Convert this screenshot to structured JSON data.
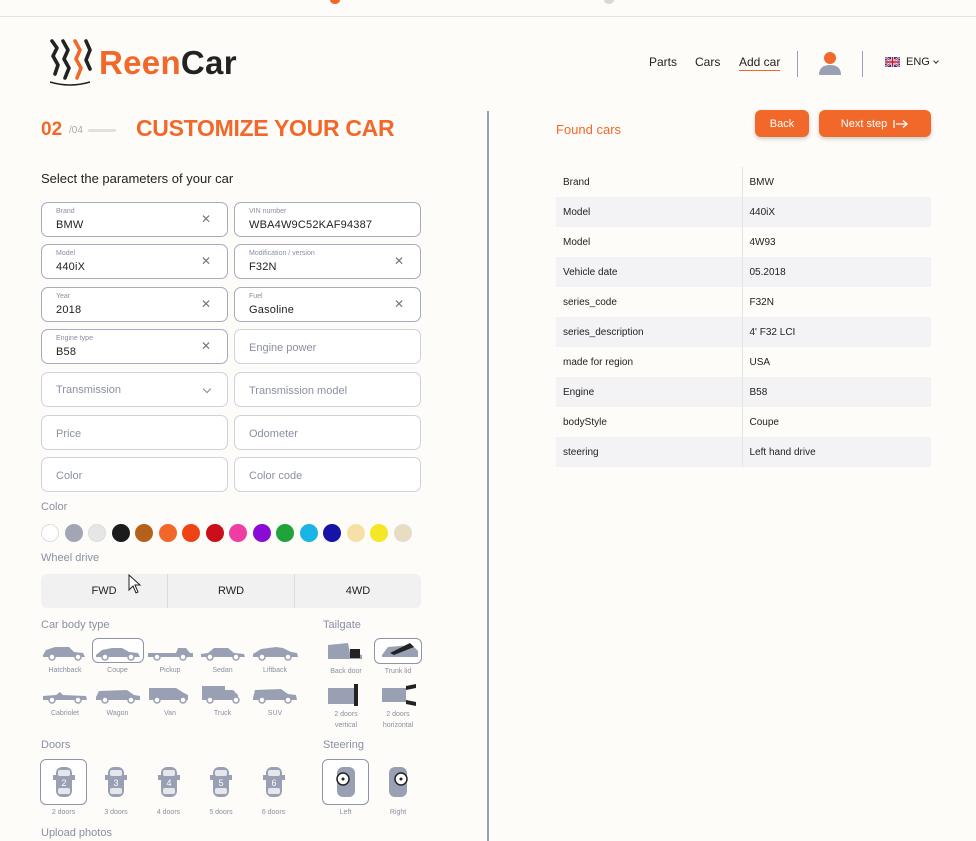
{
  "brand": {
    "name_part1": "Reen",
    "name_part2": "Car"
  },
  "nav": {
    "parts": "Parts",
    "cars": "Cars",
    "add_car": "Add car",
    "lang": "ENG"
  },
  "step": {
    "current": "02",
    "total": "/04",
    "title": "CUSTOMIZE YOUR CAR"
  },
  "form": {
    "subtitle": "Select the parameters of your car",
    "brand": {
      "label": "Brand",
      "value": "BMW"
    },
    "vin": {
      "label": "VIN number",
      "value": "WBA4W9C52KAF94387"
    },
    "model": {
      "label": "Model",
      "value": "440iX"
    },
    "modification": {
      "label": "Modification / version",
      "value": "F32N"
    },
    "year": {
      "label": "Year",
      "value": "2018"
    },
    "fuel": {
      "label": "Fuel",
      "value": "Gasoline"
    },
    "engine_type": {
      "label": "Engine type",
      "value": "B58"
    },
    "engine_power": {
      "placeholder": "Engine power"
    },
    "transmission": {
      "placeholder": "Transmission"
    },
    "transmission_model": {
      "placeholder": "Transmission model"
    },
    "price": {
      "placeholder": "Price"
    },
    "odometer": {
      "placeholder": "Odometer"
    },
    "color": {
      "placeholder": "Color"
    },
    "color_code": {
      "placeholder": "Color code"
    }
  },
  "color_section": {
    "label": "Color",
    "swatches": [
      "#ffffff",
      "#a2a6b4",
      "#e6e6e6",
      "#1b1b1b",
      "#b5601b",
      "#f2682a",
      "#f04315",
      "#cc0e1b",
      "#ee3ea3",
      "#8a0bd6",
      "#1fa33a",
      "#1ab4e6",
      "#1414a8",
      "#f7dfa8",
      "#f5e627",
      "#e9dcc0"
    ]
  },
  "wheel_drive": {
    "label": "Wheel drive",
    "options": [
      "FWD",
      "RWD",
      "4WD"
    ]
  },
  "body_type": {
    "label": "Car body type",
    "options": [
      "Hatchback",
      "Coupe",
      "Pickup",
      "Sedan",
      "Liftback",
      "Cabriolet",
      "Wagon",
      "Van",
      "Truck",
      "SUV"
    ],
    "selected": "Coupe"
  },
  "tailgate": {
    "label": "Tailgate",
    "options": [
      "Back door",
      "Trunk lid",
      "2 doors vertical",
      "2 doors horizontal"
    ],
    "selected": "Trunk lid"
  },
  "doors": {
    "label": "Doors",
    "options": [
      "2 doors",
      "3 doors",
      "4 doors",
      "5 doors",
      "6 doors"
    ],
    "numbers": [
      "2",
      "3",
      "4",
      "5",
      "6"
    ],
    "selected": "2 doors"
  },
  "steering": {
    "label": "Steering",
    "options": [
      "Left",
      "Right"
    ],
    "selected": "Left"
  },
  "upload": {
    "label": "Upload photos"
  },
  "actions": {
    "back": "Back",
    "next": "Next step"
  },
  "found_cars": {
    "title": "Found cars",
    "rows": [
      [
        "Brand",
        "BMW"
      ],
      [
        "Model",
        "440iX"
      ],
      [
        "Model",
        "4W93"
      ],
      [
        "Vehicle date",
        "05.2018"
      ],
      [
        "series_code",
        "F32N"
      ],
      [
        "series_description",
        "4' F32 LCI"
      ],
      [
        "made for region",
        "USA"
      ],
      [
        "Engine",
        "B58"
      ],
      [
        "bodyStyle",
        "Coupe"
      ],
      [
        "steering",
        "Left hand drive"
      ]
    ]
  },
  "colors": {
    "accent": "#f2682a",
    "divider": "#9aa0b4"
  }
}
